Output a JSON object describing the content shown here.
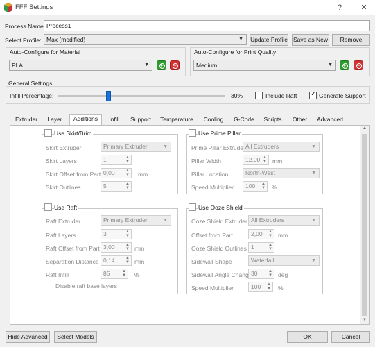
{
  "window": {
    "title": "FFF Settings",
    "help": "?",
    "close": "✕"
  },
  "process": {
    "label": "Process Name:",
    "value": "Process1"
  },
  "profile": {
    "label": "Select Profile:",
    "value": "Max (modified)",
    "update_label": "Update Profile",
    "save_as_label": "Save as New",
    "remove_label": "Remove"
  },
  "material": {
    "title": "Auto-Configure for Material",
    "value": "PLA"
  },
  "quality": {
    "title": "Auto-Configure for Print Quality",
    "value": "Medium"
  },
  "general": {
    "title": "General Settings",
    "infill_label": "Infill Percentage:",
    "infill_value": "30%",
    "infill_level": 0.3,
    "include_raft": "Include Raft",
    "include_raft_checked": false,
    "generate_support": "Generate Support",
    "generate_support_checked": true
  },
  "tabs": [
    "Extruder",
    "Layer",
    "Additions",
    "Infill",
    "Support",
    "Temperature",
    "Cooling",
    "G-Code",
    "Scripts",
    "Other",
    "Advanced"
  ],
  "active_tab": "Additions",
  "skirt": {
    "title": "Use Skirt/Brim",
    "extruder_label": "Skirt Extruder",
    "extruder_value": "Primary Extruder",
    "layers_label": "Skirt Layers",
    "layers_value": "1",
    "offset_label": "Skirt Offset from Part",
    "offset_value": "0,00",
    "offset_unit": "mm",
    "outlines_label": "Skirt Outlines",
    "outlines_value": "5"
  },
  "prime": {
    "title": "Use Prime Pillar",
    "extruder_label": "Prime Pillar Extruder",
    "extruder_value": "All Extruders",
    "width_label": "Pillar Width",
    "width_value": "12,00",
    "width_unit": "mm",
    "location_label": "Pillar Location",
    "location_value": "North-West",
    "speed_label": "Speed Multiplier",
    "speed_value": "100",
    "speed_unit": "%"
  },
  "raft": {
    "title": "Use Raft",
    "extruder_label": "Raft Extruder",
    "extruder_value": "Primary Extruder",
    "layers_label": "Raft Layers",
    "layers_value": "3",
    "offset_label": "Raft Offset from Part",
    "offset_value": "3,00",
    "offset_unit": "mm",
    "separation_label": "Separation Distance",
    "separation_value": "0,14",
    "separation_unit": "mm",
    "infill_label": "Raft Infill",
    "infill_value": "85",
    "infill_unit": "%",
    "disable_base_label": "Disable raft base layers"
  },
  "ooze": {
    "title": "Use Ooze Shield",
    "extruder_label": "Ooze Shield Extruder",
    "extruder_value": "All Extruders",
    "offset_label": "Offset from Part",
    "offset_value": "2,00",
    "offset_unit": "mm",
    "outlines_label": "Ooze Shield Outlines",
    "outlines_value": "1",
    "shape_label": "Sidewall Shape",
    "shape_value": "Waterfall",
    "angle_label": "Sidewall Angle Change",
    "angle_value": "30",
    "angle_unit": "deg",
    "speed_label": "Speed Multiplier",
    "speed_value": "100",
    "speed_unit": "%"
  },
  "footer": {
    "hide_advanced": "Hide Advanced",
    "select_models": "Select Models",
    "ok": "OK",
    "cancel": "Cancel"
  },
  "colors": {
    "accent": "#1a73d9",
    "plus": "#2e9c2e",
    "minus": "#d33333"
  }
}
